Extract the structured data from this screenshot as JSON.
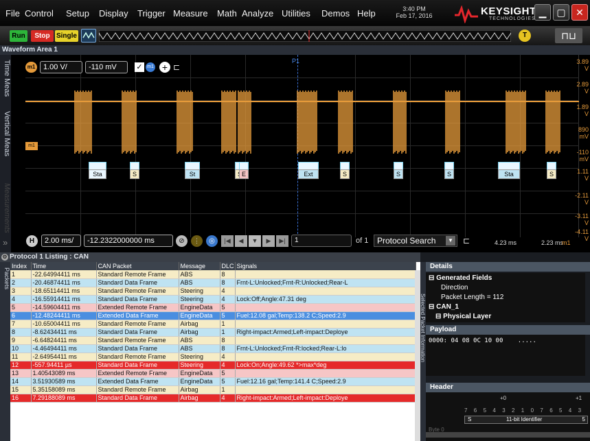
{
  "menu": [
    "File",
    "Control",
    "Setup",
    "Display",
    "Trigger",
    "Measure",
    "Math",
    "Analyze",
    "Utilities",
    "Demos",
    "Help"
  ],
  "datetime": {
    "time": "3:40 PM",
    "date": "Feb 17, 2016"
  },
  "brand": {
    "name": "KEYSIGHT",
    "sub": "TECHNOLOGIES"
  },
  "toolbar": {
    "run": "Run",
    "stop": "Stop",
    "single": "Single",
    "trigger_badge": "T"
  },
  "waveform_area": {
    "title": "Waveform Area 1",
    "marker": "P1"
  },
  "side_tabs": [
    "Time Meas",
    "Vertical Meas",
    "Measurements"
  ],
  "channel": {
    "badge": "m1",
    "scale": "1.00 V/",
    "offset": "-110 mV"
  },
  "y_axis": [
    "3.89 V",
    "2.89 V",
    "1.89 V",
    "890 mV",
    "-110 mV",
    "1.11 V",
    "-2.11 V",
    "-3.11 V",
    "-4.11 V"
  ],
  "timebase": {
    "h": "H",
    "scale": "2.00 ms/",
    "position": "-12.2322000000 ms",
    "page_value": "1",
    "page_of": "of 1",
    "search": "Protocol Search",
    "left_time": "4.23 ms",
    "right_time": "2.23 ms",
    "right_badge": "m1"
  },
  "packet_labels": [
    "Sta",
    "S",
    "St",
    "S",
    "E",
    "Ext",
    "S",
    "S",
    "S",
    "Sta",
    "S"
  ],
  "listing": {
    "title": "Protocol 1 Listing : CAN",
    "side_label": "Packets",
    "columns": [
      "Index",
      "Time",
      "CAN Packet",
      "Message",
      "DLC",
      "Signals"
    ],
    "rows": [
      [
        "1",
        "-22.64994411 ms",
        "Standard Remote Frame",
        "ABS",
        "8",
        ""
      ],
      [
        "2",
        "-20.46874411 ms",
        "Standard Data Frame",
        "ABS",
        "8",
        "Frnt-L:Unlocked;Frnt-R:Unlocked;Rear-L"
      ],
      [
        "3",
        "-18.65114411 ms",
        "Standard Remote Frame",
        "Steering",
        "4",
        ""
      ],
      [
        "4",
        "-16.55914411 ms",
        "Standard Data Frame",
        "Steering",
        "4",
        "Lock:Off;Angle:47.31 deg"
      ],
      [
        "5",
        "-14.59604411 ms",
        "Extended Remote Frame",
        "EngineData",
        "5",
        ""
      ],
      [
        "6",
        "-12.48244411 ms",
        "Extended Data Frame",
        "EngineData",
        "5",
        "Fuel:12.08 gal;Temp:138.2 C;Speed:2.9"
      ],
      [
        "7",
        "-10.65004411 ms",
        "Standard Remote Frame",
        "Airbag",
        "1",
        ""
      ],
      [
        "8",
        "-8.62434411 ms",
        "Standard Data Frame",
        "Airbag",
        "1",
        "Right-impact:Armed;Left-impact:Deploye"
      ],
      [
        "9",
        "-6.64824411 ms",
        "Standard Remote Frame",
        "ABS",
        "8",
        ""
      ],
      [
        "10",
        "-4.46494411 ms",
        "Standard Data Frame",
        "ABS",
        "8",
        "Frnt-L:Unlocked;Frnt-R:locked;Rear-L:lo"
      ],
      [
        "11",
        "-2.64954411 ms",
        "Standard Remote Frame",
        "Steering",
        "4",
        ""
      ],
      [
        "12",
        "-557.94411 µs",
        "Standard Data Frame",
        "Steering",
        "4",
        "Lock:On;Angle:49.62 *>max*deg"
      ],
      [
        "13",
        "1.40543089 ms",
        "Extended Remote Frame",
        "EngineData",
        "5",
        ""
      ],
      [
        "14",
        "3.51930589 ms",
        "Extended Data Frame",
        "EngineData",
        "5",
        "Fuel:12.16 gal;Temp:141.4 C;Speed:2.9"
      ],
      [
        "15",
        "5.35158089 ms",
        "Standard Remote Frame",
        "Airbag",
        "1",
        ""
      ],
      [
        "16",
        "7.29188089 ms",
        "Standard Data Frame",
        "Airbag",
        "4",
        "Right-impact:Armed;Left-impact:Deploye"
      ]
    ],
    "row_colors": [
      "#f6ecc6",
      "#bfe3f2",
      "#f6ecc6",
      "#bfe3f2",
      "#f6c6c6",
      "#4a8ee0",
      "#f6ecc6",
      "#bfe3f2",
      "#f6ecc6",
      "#bfe3f2",
      "#f6ecc6",
      "#e52a2a",
      "#f6c6c6",
      "#bfe3f2",
      "#f6ecc6",
      "#e52a2a"
    ]
  },
  "info_panel": {
    "side_label": "Selected Packet Information",
    "details_title": "Details",
    "tree": [
      "Generated Fields",
      "Direction",
      "Packet Length = 112",
      "CAN_1",
      "Physical Layer"
    ],
    "payload_title": "Payload",
    "payload_line": "0000:   04 08 0C 10 00",
    "payload_ascii": ".....",
    "header_title": "Header",
    "header_top": [
      "+0",
      "+1"
    ],
    "header_bits": [
      "7",
      "6",
      "5",
      "4",
      "3",
      "2",
      "1",
      "0",
      "7",
      "6",
      "5",
      "4",
      "3"
    ],
    "header_s": "S",
    "header_id": "11-bit Identifier",
    "header_five": "5",
    "byte_label": "Byte 0"
  },
  "colors": {
    "waveform": "#e59a3a",
    "selection": "#4a8ee0",
    "error": "#e52a2a"
  }
}
